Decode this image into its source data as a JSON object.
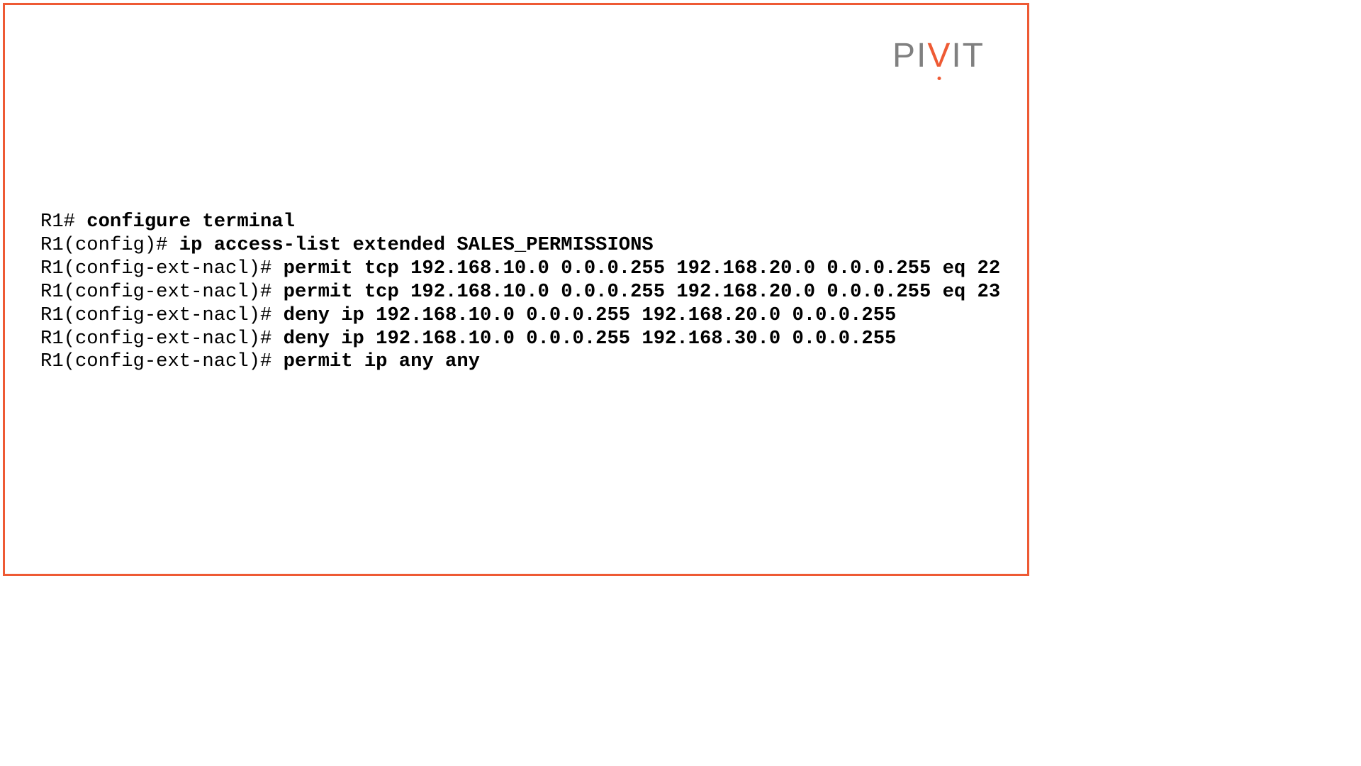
{
  "logo": {
    "p": "P",
    "i1": "I",
    "v": "V",
    "i2": "I",
    "t": "T"
  },
  "terminal": {
    "lines": [
      {
        "prompt": "R1# ",
        "cmd": "configure terminal"
      },
      {
        "prompt": "R1(config)# ",
        "cmd": "ip access-list extended SALES_PERMISSIONS"
      },
      {
        "prompt": "R1(config-ext-nacl)# ",
        "cmd": "permit tcp 192.168.10.0 0.0.0.255 192.168.20.0 0.0.0.255 eq 22"
      },
      {
        "prompt": "R1(config-ext-nacl)# ",
        "cmd": "permit tcp 192.168.10.0 0.0.0.255 192.168.20.0 0.0.0.255 eq 23"
      },
      {
        "prompt": "R1(config-ext-nacl)# ",
        "cmd": "deny ip 192.168.10.0 0.0.0.255 192.168.20.0 0.0.0.255"
      },
      {
        "prompt": "R1(config-ext-nacl)# ",
        "cmd": "deny ip 192.168.10.0 0.0.0.255 192.168.30.0 0.0.0.255"
      },
      {
        "prompt": "R1(config-ext-nacl)# ",
        "cmd": "permit ip any any"
      }
    ]
  }
}
